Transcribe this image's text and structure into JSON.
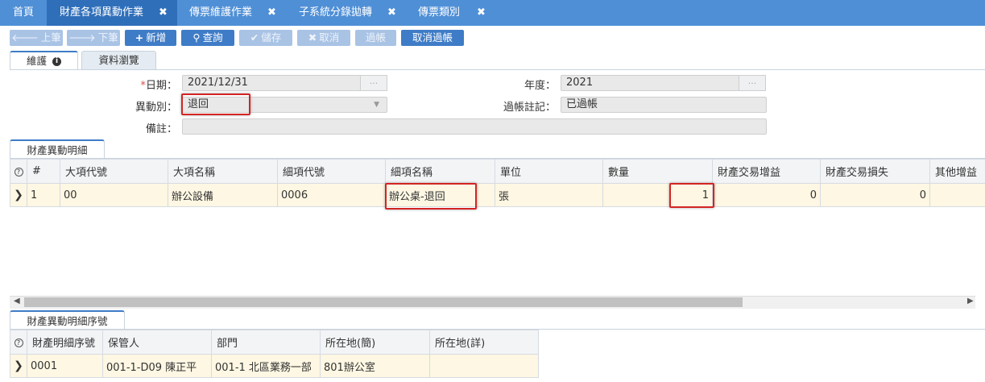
{
  "top_tabs": [
    {
      "label": "首頁"
    },
    {
      "label": "財產各項異動作業"
    },
    {
      "label": "傳票維護作業"
    },
    {
      "label": "子系統分錄拋轉"
    },
    {
      "label": "傳票類別"
    }
  ],
  "close_glyph": "✖",
  "toolbar": {
    "prev": "上筆",
    "next": "下筆",
    "add": "新增",
    "query": "查詢",
    "save": "儲存",
    "cancel": "取消",
    "post": "過帳",
    "unpost": "取消過帳"
  },
  "form_tabs": {
    "maintain": "維護",
    "browse": "資料瀏覽"
  },
  "form": {
    "date_label": "日期：",
    "date_value": "2021/12/31",
    "required_mark": "*",
    "year_label": "年度：",
    "year_value": "2021",
    "type_label": "異動別：",
    "type_value": "退回",
    "post_mark_label": "過帳註記：",
    "post_mark_value": "已過帳",
    "note_label": "備註：",
    "note_value": "",
    "ellipsis": "..."
  },
  "detail": {
    "tab_label": "財產異動明細",
    "headers": [
      "#",
      "大項代號",
      "大項名稱",
      "細項代號",
      "細項名稱",
      "單位",
      "數量",
      "財產交易增益",
      "財產交易損失",
      "其他增益"
    ],
    "rows": [
      {
        "no": "1",
        "major_code": "00",
        "major_name": "辦公設備",
        "minor_code": "0006",
        "minor_name": "辦公桌-退回",
        "unit": "張",
        "qty": "1",
        "gain": "0",
        "loss": "0",
        "other": ""
      }
    ]
  },
  "serial": {
    "tab_label": "財產異動明細序號",
    "headers": [
      "財產明細序號",
      "保管人",
      "部門",
      "所在地(簡)",
      "所在地(詳)"
    ],
    "rows": [
      {
        "serial": "0001",
        "keeper": "001-1-D09 陳正平",
        "dept": "001-1 北區業務一部",
        "loc_short": "801辦公室",
        "loc_detail": ""
      }
    ]
  }
}
